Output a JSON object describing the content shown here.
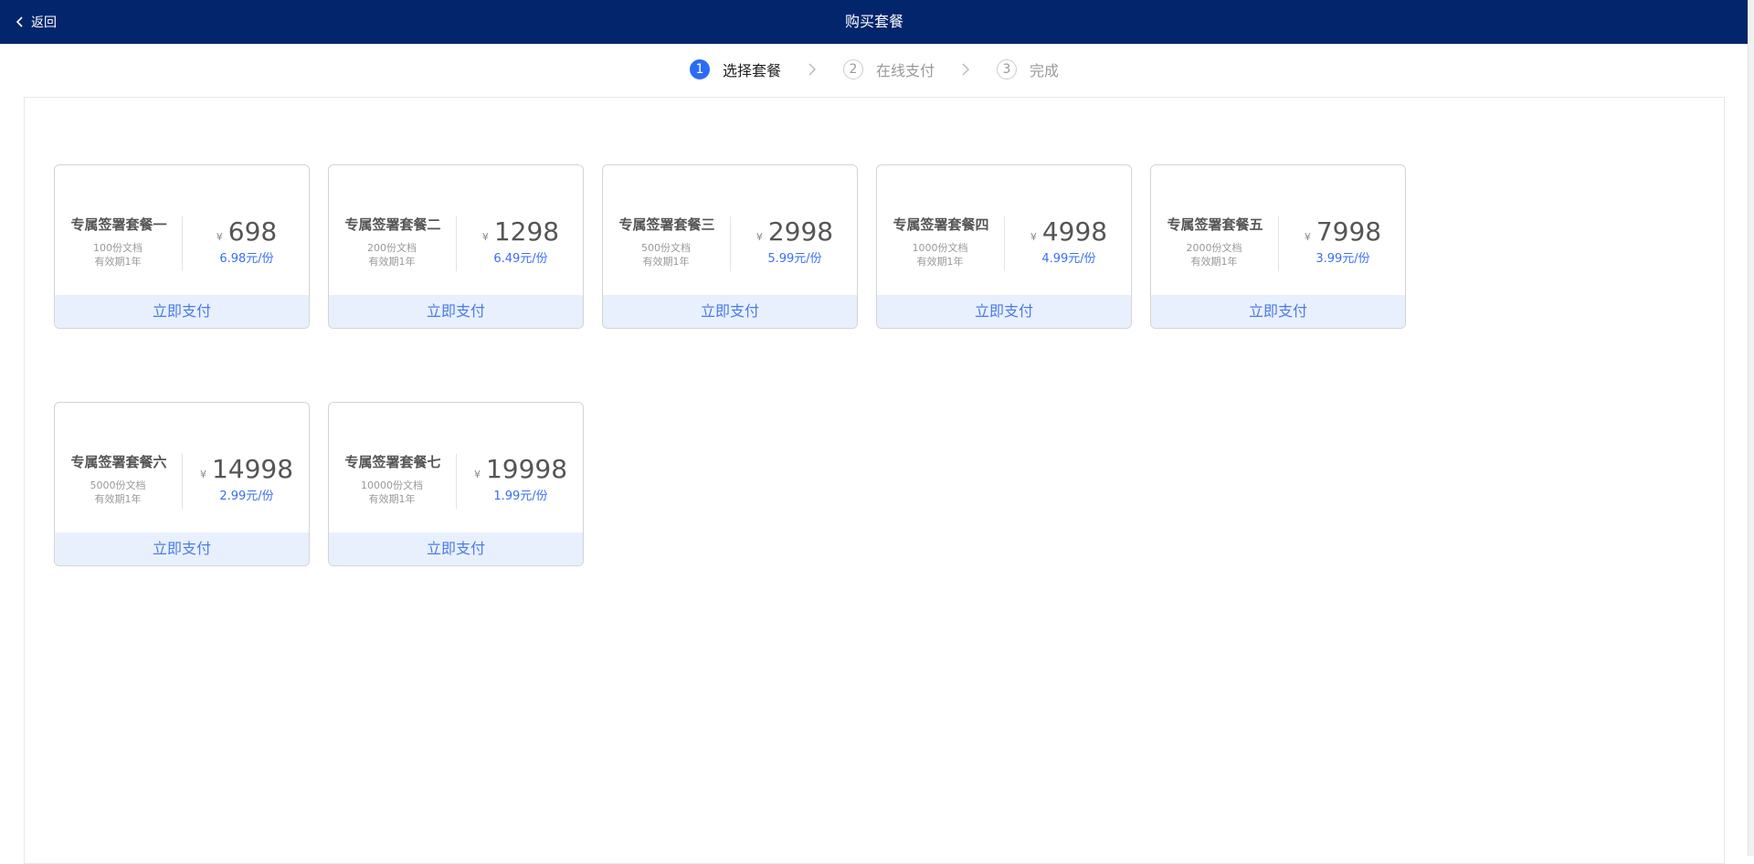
{
  "header": {
    "back_label": "返回",
    "title": "购买套餐"
  },
  "steps": [
    {
      "num": "1",
      "label": "选择套餐",
      "active": true
    },
    {
      "num": "2",
      "label": "在线支付",
      "active": false
    },
    {
      "num": "3",
      "label": "完成",
      "active": false
    }
  ],
  "packages": [
    {
      "name": "专属签署套餐一",
      "docs": "100份文档",
      "validity": "有效期1年",
      "currency": "¥",
      "price": "698",
      "unit_price": "6.98元/份",
      "pay_label": "立即支付"
    },
    {
      "name": "专属签署套餐二",
      "docs": "200份文档",
      "validity": "有效期1年",
      "currency": "¥",
      "price": "1298",
      "unit_price": "6.49元/份",
      "pay_label": "立即支付"
    },
    {
      "name": "专属签署套餐三",
      "docs": "500份文档",
      "validity": "有效期1年",
      "currency": "¥",
      "price": "2998",
      "unit_price": "5.99元/份",
      "pay_label": "立即支付"
    },
    {
      "name": "专属签署套餐四",
      "docs": "1000份文档",
      "validity": "有效期1年",
      "currency": "¥",
      "price": "4998",
      "unit_price": "4.99元/份",
      "pay_label": "立即支付"
    },
    {
      "name": "专属签署套餐五",
      "docs": "2000份文档",
      "validity": "有效期1年",
      "currency": "¥",
      "price": "7998",
      "unit_price": "3.99元/份",
      "pay_label": "立即支付"
    },
    {
      "name": "专属签署套餐六",
      "docs": "5000份文档",
      "validity": "有效期1年",
      "currency": "¥",
      "price": "14998",
      "unit_price": "2.99元/份",
      "pay_label": "立即支付"
    },
    {
      "name": "专属签署套餐七",
      "docs": "10000份文档",
      "validity": "有效期1年",
      "currency": "¥",
      "price": "19998",
      "unit_price": "1.99元/份",
      "pay_label": "立即支付"
    }
  ],
  "colors": {
    "header_bg": "#03256c",
    "accent": "#2b6cf6",
    "pay_bg": "#e8f0fd",
    "pay_text": "#4a7be8"
  }
}
